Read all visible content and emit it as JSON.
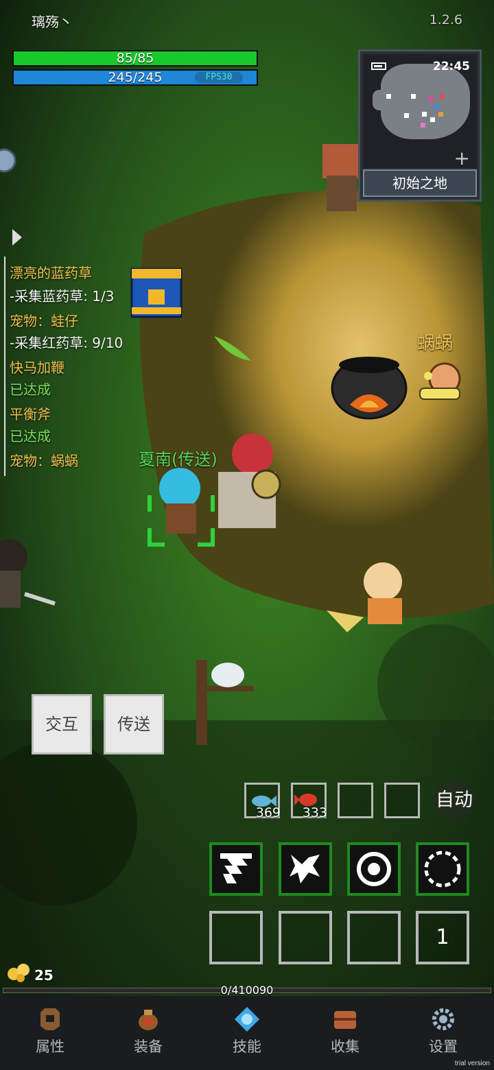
{
  "header": {
    "player_name": "璃殇丶",
    "version": "1.2.6"
  },
  "stats": {
    "hp_text": "85/85",
    "hp_fraction": 1.0,
    "mp_text": "245/245",
    "mp_fraction": 1.0,
    "fps_text": "FPS30"
  },
  "minimap": {
    "time": "22:45",
    "map_name": "初始之地",
    "zoom_icon": "plus-icon"
  },
  "quests": [
    {
      "text": "漂亮的蓝药草",
      "color": "gold"
    },
    {
      "text": "-采集蓝药草: 1/3",
      "color": "white"
    },
    {
      "text": "宠物：蛙仔",
      "color": "gold"
    },
    {
      "text": "-采集红药草: 9/10",
      "color": "white"
    },
    {
      "text": "快马加鞭",
      "color": "gold"
    },
    {
      "text": "已达成",
      "color": "green"
    },
    {
      "text": "平衡斧",
      "color": "gold"
    },
    {
      "text": "已达成",
      "color": "green"
    },
    {
      "text": "宠物：蜗蜗",
      "color": "gold"
    }
  ],
  "world": {
    "snail_name": "蜗蜗",
    "npc_name": "夏南(传送)"
  },
  "actions": {
    "interact": "交互",
    "teleport": "传送"
  },
  "consumables": [
    {
      "icon": "blue-fish-icon",
      "count": "369"
    },
    {
      "icon": "red-fish-icon",
      "count": "333"
    },
    {
      "icon": "",
      "count": ""
    },
    {
      "icon": "",
      "count": ""
    }
  ],
  "auto_label": "自动",
  "skills": [
    "skill-rune-1-icon",
    "skill-rune-2-icon",
    "skill-rune-3-icon",
    "skill-rune-4-icon"
  ],
  "skill_slot_count": "1",
  "gold": "25",
  "exp_text": "0/410090",
  "nav": [
    {
      "label": "属性",
      "icon": "helmet-icon"
    },
    {
      "label": "装备",
      "icon": "bag-icon"
    },
    {
      "label": "技能",
      "icon": "crystal-icon"
    },
    {
      "label": "收集",
      "icon": "chest-icon"
    },
    {
      "label": "设置",
      "icon": "gear-icon"
    }
  ],
  "watermark": "trial version"
}
